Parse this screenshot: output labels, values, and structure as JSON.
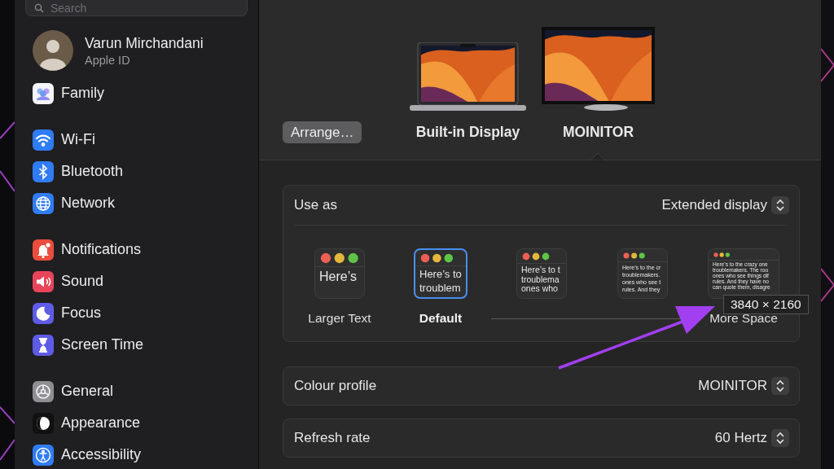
{
  "sidebar": {
    "search": {
      "placeholder": "Search"
    },
    "account": {
      "name": "Varun Mirchandani",
      "subtitle": "Apple ID"
    },
    "groups": [
      {
        "items": [
          {
            "label": "Family",
            "kind": "family"
          }
        ]
      },
      {
        "items": [
          {
            "label": "Wi-Fi",
            "kind": "wifi"
          },
          {
            "label": "Bluetooth",
            "kind": "bluetooth"
          },
          {
            "label": "Network",
            "kind": "network"
          }
        ]
      },
      {
        "items": [
          {
            "label": "Notifications",
            "kind": "notifications"
          },
          {
            "label": "Sound",
            "kind": "sound"
          },
          {
            "label": "Focus",
            "kind": "focus"
          },
          {
            "label": "Screen Time",
            "kind": "screentime"
          }
        ]
      },
      {
        "items": [
          {
            "label": "General",
            "kind": "general"
          },
          {
            "label": "Appearance",
            "kind": "appearance"
          },
          {
            "label": "Accessibility",
            "kind": "accessibility"
          }
        ]
      }
    ]
  },
  "arrange_button": "Arrange…",
  "displays": [
    {
      "name": "Built-in Display",
      "kind": "laptop",
      "selected": false
    },
    {
      "name": "MOINITOR",
      "kind": "monitor",
      "selected": true
    }
  ],
  "use_as": {
    "label": "Use as",
    "value": "Extended display"
  },
  "scale_options": [
    {
      "label": "Larger Text",
      "preview": [
        "Here’s"
      ],
      "selected": false
    },
    {
      "label": "Default",
      "preview": [
        "Here’s to",
        "troublem"
      ],
      "selected": true
    },
    {
      "preview": [
        "Here’s to t",
        "troublema",
        "ones who"
      ],
      "selected": false
    },
    {
      "preview": [
        "Here’s to the cr",
        "troublemakers.",
        "ones who see t",
        "rules. And they"
      ],
      "selected": false
    },
    {
      "label": "More Space",
      "preview": [
        "Here’s to the crazy one",
        "troublemakers. The rou",
        "ones who see things dif",
        "rules. And they have no",
        "can quote them, disagre"
      ],
      "selected": false
    }
  ],
  "tooltip": "3840 × 2160",
  "settings": [
    {
      "label": "Colour profile",
      "value": "MOINITOR"
    },
    {
      "label": "Refresh rate",
      "value": "60 Hertz"
    }
  ]
}
